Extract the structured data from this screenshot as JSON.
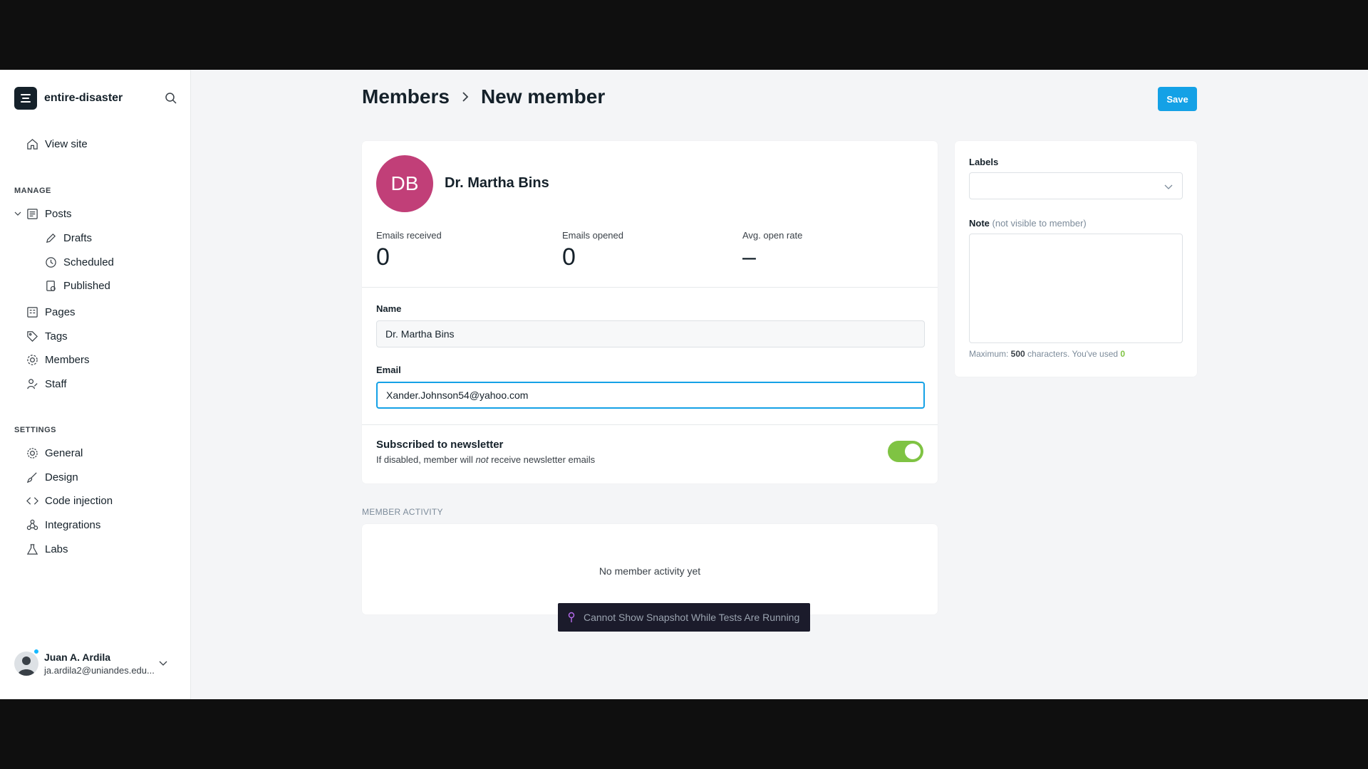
{
  "sidebar": {
    "brand": "entire-disaster",
    "view_site": "View site",
    "manage_title": "MANAGE",
    "posts": "Posts",
    "drafts": "Drafts",
    "scheduled": "Scheduled",
    "published": "Published",
    "pages": "Pages",
    "tags": "Tags",
    "members": "Members",
    "staff": "Staff",
    "settings_title": "SETTINGS",
    "general": "General",
    "design": "Design",
    "code_injection": "Code injection",
    "integrations": "Integrations",
    "labs": "Labs",
    "user": {
      "name": "Juan A. Ardila",
      "email": "ja.ardila2@uniandes.edu..."
    }
  },
  "header": {
    "breadcrumb_parent": "Members",
    "breadcrumb_current": "New member",
    "save_label": "Save"
  },
  "member": {
    "initials": "DB",
    "name": "Dr. Martha Bins",
    "avatar_color": "#c13f78",
    "stats": [
      {
        "label": "Emails received",
        "value": "0"
      },
      {
        "label": "Emails opened",
        "value": "0"
      },
      {
        "label": "Avg. open rate",
        "value": "–"
      }
    ],
    "name_label": "Name",
    "name_value": "Dr. Martha Bins",
    "email_label": "Email",
    "email_value": "Xander.Johnson54@yahoo.com",
    "newsletter_title": "Subscribed to newsletter",
    "newsletter_sub_prefix": "If disabled, member will ",
    "newsletter_sub_em": "not",
    "newsletter_sub_suffix": " receive newsletter emails",
    "subscribed": true
  },
  "activity": {
    "title": "MEMBER ACTIVITY",
    "empty": "No member activity yet"
  },
  "side": {
    "labels_title": "Labels",
    "note_title": "Note",
    "note_muted": "(not visible to member)",
    "hint_prefix": "Maximum: ",
    "hint_max": "500",
    "hint_mid": " characters. You've used ",
    "hint_used": "0"
  },
  "toast": {
    "text": "Cannot Show Snapshot While Tests Are Running"
  },
  "colors": {
    "accent": "#14a1e6",
    "toggle_on": "#7fc343"
  }
}
